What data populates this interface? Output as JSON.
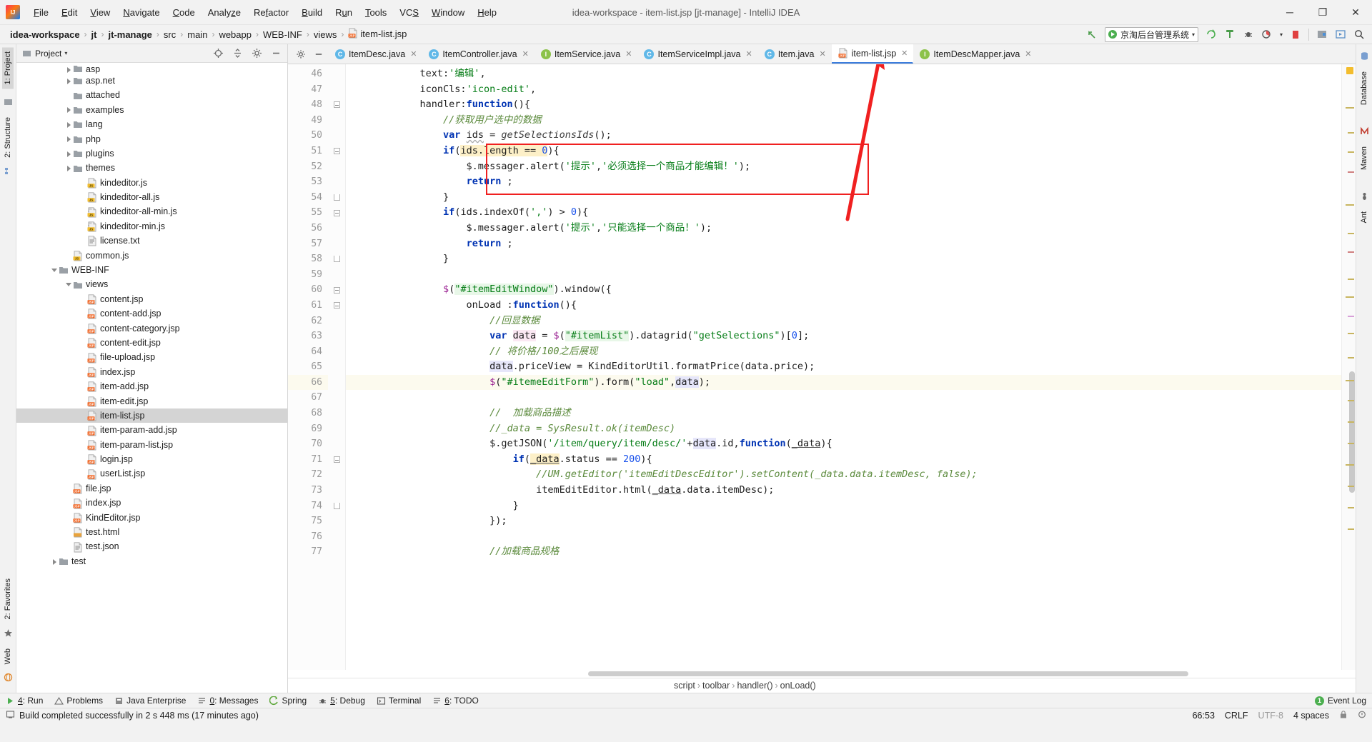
{
  "titlebar": {
    "window_title": "idea-workspace - item-list.jsp [jt-manage] - IntelliJ IDEA",
    "menus": [
      "File",
      "Edit",
      "View",
      "Navigate",
      "Code",
      "Analyze",
      "Refactor",
      "Build",
      "Run",
      "Tools",
      "VCS",
      "Window",
      "Help"
    ],
    "minimize": "─",
    "maximize": "❐",
    "close": "✕"
  },
  "navbar": {
    "crumbs": [
      {
        "label": "idea-workspace",
        "bold": true,
        "icon": ""
      },
      {
        "label": "jt",
        "bold": true,
        "icon": ""
      },
      {
        "label": "jt-manage",
        "bold": true,
        "icon": ""
      },
      {
        "label": "src",
        "bold": false,
        "icon": ""
      },
      {
        "label": "main",
        "bold": false,
        "icon": ""
      },
      {
        "label": "webapp",
        "bold": false,
        "icon": ""
      },
      {
        "label": "WEB-INF",
        "bold": false,
        "icon": ""
      },
      {
        "label": "views",
        "bold": false,
        "icon": ""
      },
      {
        "label": "item-list.jsp",
        "bold": false,
        "icon": "jsp"
      }
    ],
    "separator": "›",
    "run_config": "京淘后台管理系统",
    "icons": [
      "update-project-icon",
      "run-icon",
      "debug-icon",
      "coverage-icon",
      "profile-icon",
      "stop-icon",
      "sdk-icon",
      "preview-icon",
      "search-everywhere-icon"
    ]
  },
  "left_rail": {
    "items": [
      "1: Project",
      "2: Structure",
      "2: Favorites",
      "Web"
    ]
  },
  "right_rail": {
    "items": [
      "Database",
      "Maven",
      "Ant"
    ]
  },
  "project_panel": {
    "title": "Project",
    "caret": "▾",
    "header_icons": [
      "locate-icon",
      "collapse-all-icon",
      "settings-icon",
      "hide-icon"
    ],
    "tree": [
      {
        "depth": 3,
        "arrow": "closed",
        "icon": "folder",
        "label": "asp",
        "selected": false,
        "clipped": true
      },
      {
        "depth": 3,
        "arrow": "closed",
        "icon": "folder",
        "label": "asp.net",
        "selected": false
      },
      {
        "depth": 3,
        "arrow": "none",
        "icon": "folder",
        "label": "attached",
        "selected": false
      },
      {
        "depth": 3,
        "arrow": "closed",
        "icon": "folder",
        "label": "examples",
        "selected": false
      },
      {
        "depth": 3,
        "arrow": "closed",
        "icon": "folder",
        "label": "lang",
        "selected": false
      },
      {
        "depth": 3,
        "arrow": "closed",
        "icon": "folder",
        "label": "php",
        "selected": false
      },
      {
        "depth": 3,
        "arrow": "closed",
        "icon": "folder",
        "label": "plugins",
        "selected": false
      },
      {
        "depth": 3,
        "arrow": "closed",
        "icon": "folder",
        "label": "themes",
        "selected": false
      },
      {
        "depth": 4,
        "arrow": "none",
        "icon": "js",
        "label": "kindeditor.js",
        "selected": false
      },
      {
        "depth": 4,
        "arrow": "none",
        "icon": "js",
        "label": "kindeditor-all.js",
        "selected": false
      },
      {
        "depth": 4,
        "arrow": "none",
        "icon": "jsmin",
        "label": "kindeditor-all-min.js",
        "selected": false
      },
      {
        "depth": 4,
        "arrow": "none",
        "icon": "jsmin",
        "label": "kindeditor-min.js",
        "selected": false
      },
      {
        "depth": 4,
        "arrow": "none",
        "icon": "txt",
        "label": "license.txt",
        "selected": false
      },
      {
        "depth": 3,
        "arrow": "none",
        "icon": "js",
        "label": "common.js",
        "selected": false
      },
      {
        "depth": 2,
        "arrow": "open",
        "icon": "folder",
        "label": "WEB-INF",
        "selected": false
      },
      {
        "depth": 3,
        "arrow": "open",
        "icon": "folder",
        "label": "views",
        "selected": false
      },
      {
        "depth": 4,
        "arrow": "none",
        "icon": "jsp",
        "label": "content.jsp",
        "selected": false
      },
      {
        "depth": 4,
        "arrow": "none",
        "icon": "jsp",
        "label": "content-add.jsp",
        "selected": false
      },
      {
        "depth": 4,
        "arrow": "none",
        "icon": "jsp",
        "label": "content-category.jsp",
        "selected": false
      },
      {
        "depth": 4,
        "arrow": "none",
        "icon": "jsp",
        "label": "content-edit.jsp",
        "selected": false
      },
      {
        "depth": 4,
        "arrow": "none",
        "icon": "jsp",
        "label": "file-upload.jsp",
        "selected": false
      },
      {
        "depth": 4,
        "arrow": "none",
        "icon": "jsp",
        "label": "index.jsp",
        "selected": false
      },
      {
        "depth": 4,
        "arrow": "none",
        "icon": "jsp",
        "label": "item-add.jsp",
        "selected": false
      },
      {
        "depth": 4,
        "arrow": "none",
        "icon": "jsp",
        "label": "item-edit.jsp",
        "selected": false
      },
      {
        "depth": 4,
        "arrow": "none",
        "icon": "jsp",
        "label": "item-list.jsp",
        "selected": true
      },
      {
        "depth": 4,
        "arrow": "none",
        "icon": "jsp",
        "label": "item-param-add.jsp",
        "selected": false
      },
      {
        "depth": 4,
        "arrow": "none",
        "icon": "jsp",
        "label": "item-param-list.jsp",
        "selected": false
      },
      {
        "depth": 4,
        "arrow": "none",
        "icon": "jsp",
        "label": "login.jsp",
        "selected": false
      },
      {
        "depth": 4,
        "arrow": "none",
        "icon": "jsp",
        "label": "userList.jsp",
        "selected": false
      },
      {
        "depth": 3,
        "arrow": "none",
        "icon": "jsp",
        "label": "file.jsp",
        "selected": false
      },
      {
        "depth": 3,
        "arrow": "none",
        "icon": "jsp",
        "label": "index.jsp",
        "selected": false
      },
      {
        "depth": 3,
        "arrow": "none",
        "icon": "jsp",
        "label": "KindEditor.jsp",
        "selected": false
      },
      {
        "depth": 3,
        "arrow": "none",
        "icon": "html",
        "label": "test.html",
        "selected": false
      },
      {
        "depth": 3,
        "arrow": "none",
        "icon": "json",
        "label": "test.json",
        "selected": false
      },
      {
        "depth": 2,
        "arrow": "closed",
        "icon": "folder",
        "label": "test",
        "selected": false
      }
    ]
  },
  "editor": {
    "tabs": [
      {
        "label": "ItemDesc.java",
        "icon": "class-icon",
        "kind": "c",
        "active": false
      },
      {
        "label": "ItemController.java",
        "icon": "class-icon",
        "kind": "c",
        "active": false
      },
      {
        "label": "ItemService.java",
        "icon": "interface-icon",
        "kind": "i",
        "active": false
      },
      {
        "label": "ItemServiceImpl.java",
        "icon": "class-icon",
        "kind": "c",
        "active": false
      },
      {
        "label": "Item.java",
        "icon": "class-icon",
        "kind": "c",
        "active": false
      },
      {
        "label": "item-list.jsp",
        "icon": "jsp-icon",
        "kind": "jsp",
        "active": true
      },
      {
        "label": "ItemDescMapper.java",
        "icon": "interface-icon",
        "kind": "i",
        "active": false
      }
    ],
    "close_glyph": "✕",
    "first_line": 46,
    "lines": [
      {
        "n": 46,
        "fold": "",
        "highlight": false,
        "text": "            text:'编辑',"
      },
      {
        "n": 47,
        "fold": "",
        "highlight": false,
        "text": "            iconCls:'icon-edit',"
      },
      {
        "n": 48,
        "fold": "start",
        "highlight": false,
        "text": "            handler:function(){"
      },
      {
        "n": 49,
        "fold": "",
        "highlight": false,
        "text": "                //获取用户选中的数据"
      },
      {
        "n": 50,
        "fold": "",
        "highlight": false,
        "text": "                var ids = getSelectionsIds();"
      },
      {
        "n": 51,
        "fold": "start",
        "highlight": false,
        "text": "                if(ids.length == 0){"
      },
      {
        "n": 52,
        "fold": "",
        "highlight": false,
        "text": "                    $.messager.alert('提示','必须选择一个商品才能编辑！');"
      },
      {
        "n": 53,
        "fold": "",
        "highlight": false,
        "text": "                    return ;"
      },
      {
        "n": 54,
        "fold": "end",
        "highlight": false,
        "text": "                }"
      },
      {
        "n": 55,
        "fold": "start",
        "highlight": false,
        "text": "                if(ids.indexOf(',') > 0){"
      },
      {
        "n": 56,
        "fold": "",
        "highlight": false,
        "text": "                    $.messager.alert('提示','只能选择一个商品！');"
      },
      {
        "n": 57,
        "fold": "",
        "highlight": false,
        "text": "                    return ;"
      },
      {
        "n": 58,
        "fold": "end",
        "highlight": false,
        "text": "                }"
      },
      {
        "n": 59,
        "fold": "",
        "highlight": false,
        "text": ""
      },
      {
        "n": 60,
        "fold": "start",
        "highlight": false,
        "text": "                $(\"#itemEditWindow\").window({"
      },
      {
        "n": 61,
        "fold": "start",
        "highlight": false,
        "text": "                    onLoad :function(){"
      },
      {
        "n": 62,
        "fold": "",
        "highlight": false,
        "text": "                        //回显数据"
      },
      {
        "n": 63,
        "fold": "",
        "highlight": false,
        "text": "                        var data = $(\"#itemList\").datagrid(\"getSelections\")[0];"
      },
      {
        "n": 64,
        "fold": "",
        "highlight": false,
        "text": "                        // 将价格/100之后展现"
      },
      {
        "n": 65,
        "fold": "",
        "highlight": false,
        "text": "                        data.priceView = KindEditorUtil.formatPrice(data.price);"
      },
      {
        "n": 66,
        "fold": "",
        "highlight": true,
        "text": "                        $(\"#itemeEditForm\").form(\"load\",data);"
      },
      {
        "n": 67,
        "fold": "",
        "highlight": false,
        "text": ""
      },
      {
        "n": 68,
        "fold": "",
        "highlight": false,
        "text": "                        //  加载商品描述"
      },
      {
        "n": 69,
        "fold": "",
        "highlight": false,
        "text": "                        //_data = SysResult.ok(itemDesc)"
      },
      {
        "n": 70,
        "fold": "",
        "highlight": false,
        "text": "                        $.getJSON('/item/query/item/desc/'+data.id,function(_data){"
      },
      {
        "n": 71,
        "fold": "start",
        "highlight": false,
        "text": "                            if(_data.status == 200){"
      },
      {
        "n": 72,
        "fold": "",
        "highlight": false,
        "text": "                                //UM.getEditor('itemEditDescEditor').setContent(_data.data.itemDesc, false);"
      },
      {
        "n": 73,
        "fold": "",
        "highlight": false,
        "text": "                                itemEditEditor.html(_data.data.itemDesc);"
      },
      {
        "n": 74,
        "fold": "end",
        "highlight": false,
        "text": "                            }"
      },
      {
        "n": 75,
        "fold": "",
        "highlight": false,
        "text": "                        });"
      },
      {
        "n": 76,
        "fold": "",
        "highlight": false,
        "text": ""
      },
      {
        "n": 77,
        "fold": "",
        "highlight": false,
        "text": "                        //加载商品规格"
      }
    ],
    "breadcrumbs": [
      "script",
      "toolbar",
      "handler()",
      "onLoad()"
    ],
    "breadcrumb_sep": "›",
    "annotation": {
      "type": "red-rectangle-and-arrow",
      "color": "#f02020",
      "highlights_lines": [
        68,
        69,
        70
      ]
    }
  },
  "tool_window_bar": {
    "items": [
      {
        "label": "4: Run",
        "icon": "run-icon"
      },
      {
        "label": "Problems",
        "icon": "warning-icon"
      },
      {
        "label": "Java Enterprise",
        "icon": "java-ee-icon"
      },
      {
        "label": "0: Messages",
        "icon": "messages-icon"
      },
      {
        "label": "Spring",
        "icon": "spring-icon"
      },
      {
        "label": "5: Debug",
        "icon": "debug-icon"
      },
      {
        "label": "Terminal",
        "icon": "terminal-icon"
      },
      {
        "label": "6: TODO",
        "icon": "todo-icon"
      }
    ],
    "event_log": "Event Log",
    "event_count": "1"
  },
  "statusbar": {
    "message": "Build completed successfully in 2 s 448 ms (17 minutes ago)",
    "caret_position": "66:53",
    "line_separator": "CRLF",
    "encoding": "UTF-8",
    "indent": "4 spaces",
    "lock_icon": "lock-icon",
    "inspection_icon": "inspection-icon"
  },
  "colors": {
    "accent_blue": "#3b7ddd",
    "annotation_red": "#f02020",
    "jsp_tag": "#f26522",
    "js_tag": "#f3bd2e",
    "chrome_bg": "#f2f2f2",
    "editor_bg": "#ffffff"
  }
}
